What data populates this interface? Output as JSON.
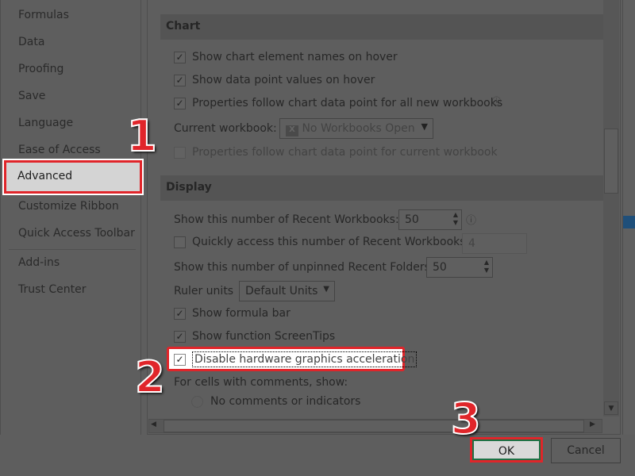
{
  "sidebar": {
    "items": [
      {
        "label": "Formulas"
      },
      {
        "label": "Data"
      },
      {
        "label": "Proofing"
      },
      {
        "label": "Save"
      },
      {
        "label": "Language"
      },
      {
        "label": "Ease of Access"
      },
      {
        "label": "Advanced",
        "selected": true
      },
      {
        "label": "Customize Ribbon"
      },
      {
        "label": "Quick Access Toolbar"
      },
      {
        "label": "Add-ins"
      },
      {
        "label": "Trust Center"
      }
    ]
  },
  "chart": {
    "title": "Chart",
    "show_names": {
      "label": "Show chart element names on hover",
      "checked": true
    },
    "show_values": {
      "label": "Show data point values on hover",
      "checked": true
    },
    "props_all": {
      "label": "Properties follow chart data point for all new workbooks",
      "checked": true
    },
    "current_workbook_label": "Current workbook:",
    "current_workbook_value": "No Workbooks Open",
    "props_current": {
      "label": "Properties follow chart data point for current workbook",
      "checked": false
    }
  },
  "display": {
    "title": "Display",
    "recent_workbooks_label": "Show this number of Recent Workbooks:",
    "recent_workbooks_value": "50",
    "quick_access": {
      "label": "Quickly access this number of Recent Workbooks:",
      "checked": false,
      "value": "4"
    },
    "recent_folders_label": "Show this number of unpinned Recent Folders:",
    "recent_folders_value": "50",
    "ruler_label": "Ruler units",
    "ruler_value": "Default Units",
    "formula_bar": {
      "label": "Show formula bar",
      "checked": true
    },
    "screentips": {
      "label": "Show function ScreenTips",
      "checked": true
    },
    "hw_accel": {
      "label": "Disable hardware graphics acceleration",
      "checked": true
    },
    "comments_label": "For cells with comments, show:",
    "no_comments": {
      "label": "No comments or indicators"
    }
  },
  "buttons": {
    "ok": "OK",
    "cancel": "Cancel"
  },
  "annotations": {
    "step1": "1",
    "step2": "2",
    "step3": "3"
  },
  "colors": {
    "highlight": "#e0252a",
    "ok_border": "#1e7145"
  }
}
